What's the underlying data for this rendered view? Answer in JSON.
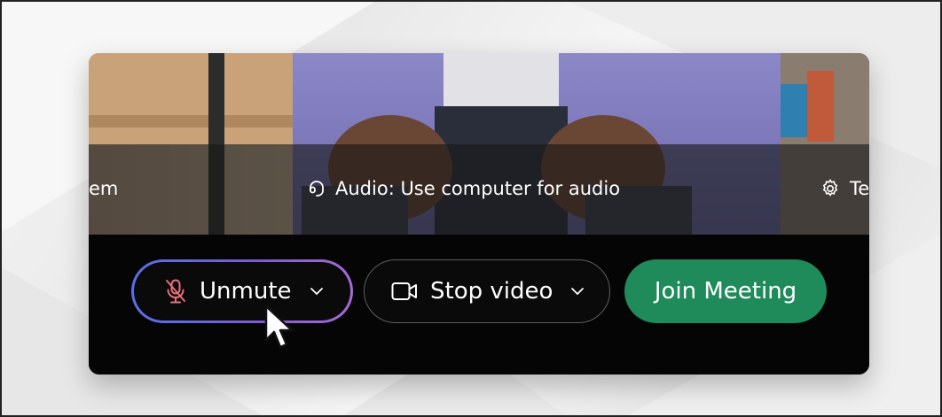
{
  "options": {
    "left_partial": "em",
    "audio_label": "Audio: Use computer for audio",
    "right_partial": "Te"
  },
  "controls": {
    "unmute_label": "Unmute",
    "video_label": "Stop video",
    "join_label": "Join Meeting"
  },
  "colors": {
    "join_button": "#1f8a5a",
    "muted_mic_icon": "#e8707a",
    "unmute_ring_start": "#5b6ee8",
    "unmute_ring_end": "#a56ad6"
  },
  "icons": {
    "audio": "headset-icon",
    "settings": "gear-icon",
    "mic": "microphone-muted-icon",
    "video": "video-camera-icon",
    "dropdown": "chevron-down-icon",
    "cursor": "mouse-pointer-icon"
  }
}
